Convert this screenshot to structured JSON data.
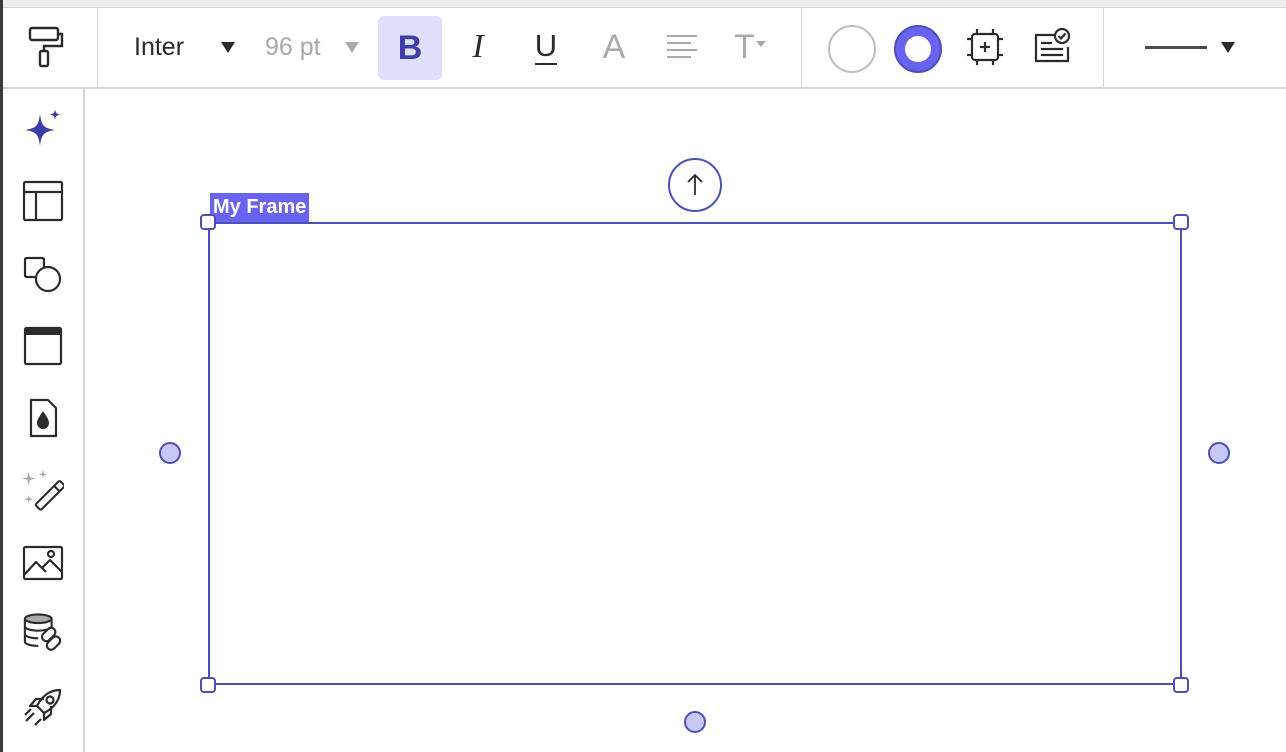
{
  "toolbar": {
    "font_family": "Inter",
    "font_size": "96 pt",
    "bold_label": "B",
    "italic_label": "I",
    "underline_label": "U",
    "text_color_label": "A",
    "text_transform_label": "T",
    "items": [
      {
        "name": "format-painter-icon"
      },
      {
        "name": "font-family-dropdown"
      },
      {
        "name": "font-size-dropdown"
      },
      {
        "name": "bold-button",
        "active": true
      },
      {
        "name": "italic-button"
      },
      {
        "name": "underline-button"
      },
      {
        "name": "text-color-button"
      },
      {
        "name": "text-align-button"
      },
      {
        "name": "text-options-button"
      },
      {
        "name": "fill-color-button"
      },
      {
        "name": "stroke-color-button"
      },
      {
        "name": "frame-crop-button"
      },
      {
        "name": "checklist-button"
      },
      {
        "name": "line-style-dropdown"
      }
    ]
  },
  "sidebar": {
    "items": [
      {
        "name": "ai-sparkle-icon"
      },
      {
        "name": "layout-template-icon"
      },
      {
        "name": "shapes-icon"
      },
      {
        "name": "container-frame-icon"
      },
      {
        "name": "fill-drop-icon"
      },
      {
        "name": "magic-wand-icon"
      },
      {
        "name": "image-icon"
      },
      {
        "name": "data-link-icon"
      },
      {
        "name": "rocket-icon"
      }
    ]
  },
  "canvas": {
    "frame_label": "My Frame"
  },
  "colors": {
    "accent": "#4b50b8",
    "selection_fill": "#6a62f0",
    "active_button_bg": "#dedffa",
    "handle_fill": "#c7c8f4",
    "icon_purple": "#3d3da8"
  }
}
